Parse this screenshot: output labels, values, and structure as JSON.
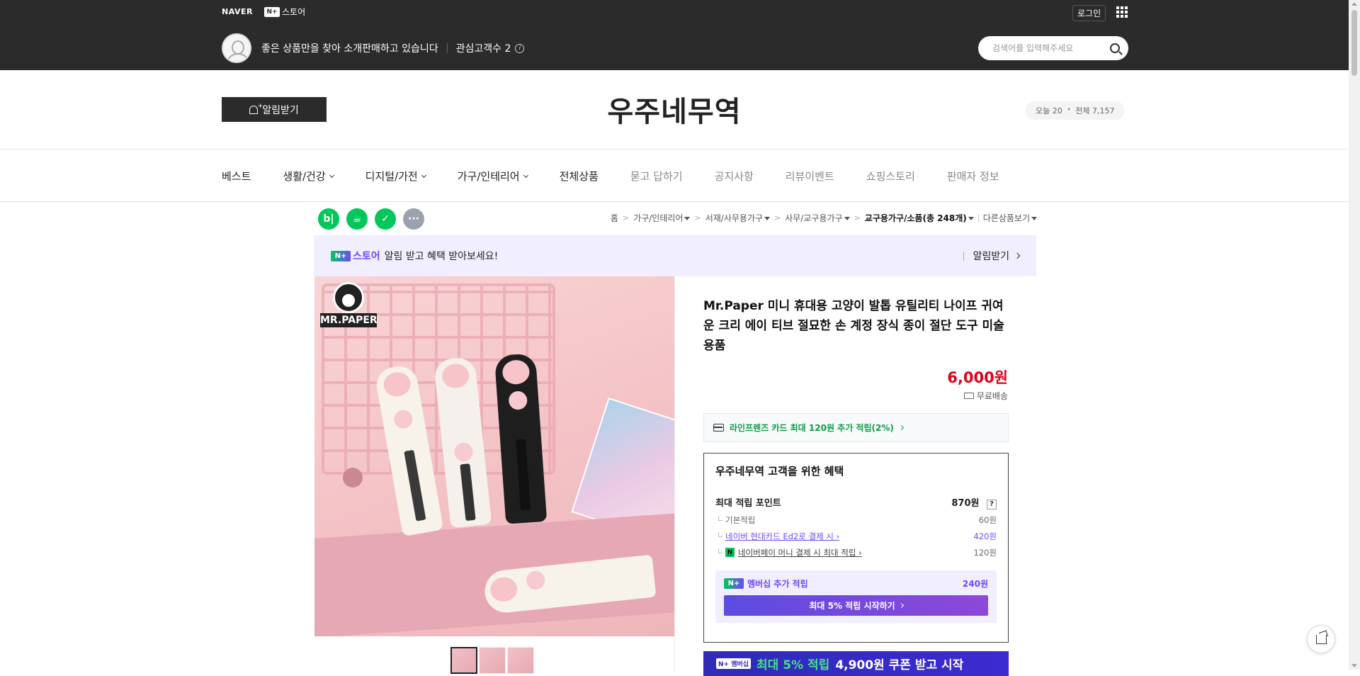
{
  "gnb": {
    "naver_logo": "NAVER",
    "nplus_store_icon": "N+",
    "nplus_store_label": "스토어",
    "login_label": "로그인",
    "apps_icon": "grid-icon"
  },
  "seller": {
    "description": "좋은 상품만을 찾아 소개판매하고 있습니다",
    "fans_label": "관심고객수 2",
    "search_placeholder": "검색어를 입력해주세요"
  },
  "store_header": {
    "alarm_label": "알림받기",
    "store_name": "우주네무역",
    "visit_today": "오늘 20",
    "visit_total": "전체 7,157"
  },
  "category_nav": [
    {
      "label": "베스트",
      "dropdown": false,
      "dim": false
    },
    {
      "label": "생활/건강",
      "dropdown": true,
      "dim": false
    },
    {
      "label": "디지털/가전",
      "dropdown": true,
      "dim": false
    },
    {
      "label": "가구/인테리어",
      "dropdown": true,
      "dim": false
    },
    {
      "label": "전체상품",
      "dropdown": false,
      "dim": false
    },
    {
      "label": "묻고 답하기",
      "dropdown": false,
      "dim": true
    },
    {
      "label": "공지사항",
      "dropdown": false,
      "dim": true
    },
    {
      "label": "리뷰이벤트",
      "dropdown": false,
      "dim": true
    },
    {
      "label": "쇼핑스토리",
      "dropdown": false,
      "dim": true
    },
    {
      "label": "판매자 정보",
      "dropdown": false,
      "dim": true
    }
  ],
  "share": {
    "blog": "b|",
    "more": "···"
  },
  "breadcrumb": {
    "home": "홈",
    "cat1": "가구/인테리어",
    "cat2": "서재/사무용가구",
    "cat3": "사무/교구용가구",
    "cat4": "교구용가구/소품(총 248개)",
    "other": "다른상품보기"
  },
  "promo": {
    "badge": "N+",
    "store": "스토어",
    "text": "알림 받고 혜택 받아보세요!",
    "action": "알림받기"
  },
  "product": {
    "brand_badge": "MR.PAPER",
    "title": "Mr.Paper 미니 휴대용 고양이 발톱 유틸리티 나이프 귀여운 크리 에이 티브 절묘한 손 계정 장식 종이 절단 도구 미술 용품",
    "price": "6,000원",
    "shipping": "무료배송",
    "card_benefit": "라인프렌즈 카드 최대 120원 추가 적립(2%)"
  },
  "benefit": {
    "title": "우주네무역 고객을 위한 혜택",
    "max_points_label": "최대 적립 포인트",
    "max_points_value": "870원",
    "help": "?",
    "rows": [
      {
        "label": "기본적립",
        "value": "60원"
      },
      {
        "label": "네이버 현대카드 Ed2로 결제 시",
        "value": "420원"
      },
      {
        "label": "네이버페이 머니 결제 시 최대 적립",
        "value": "120원"
      }
    ],
    "npay_icon": "N",
    "member_badge": "N+",
    "member_label": "멤버십 추가 적립",
    "member_value": "240원",
    "member_button": "최대 5% 적립 시작하기"
  },
  "member_banner": {
    "badge": "N+ 멤버십",
    "green_text": "최대 5% 적립",
    "white_text": "4,900원 쿠폰 받고 시작"
  },
  "colors": {
    "top_bar": "#2b2b2b",
    "price": "#e2001a",
    "naver_green": "#03c75a",
    "membership_purple": "#6f47ff"
  }
}
